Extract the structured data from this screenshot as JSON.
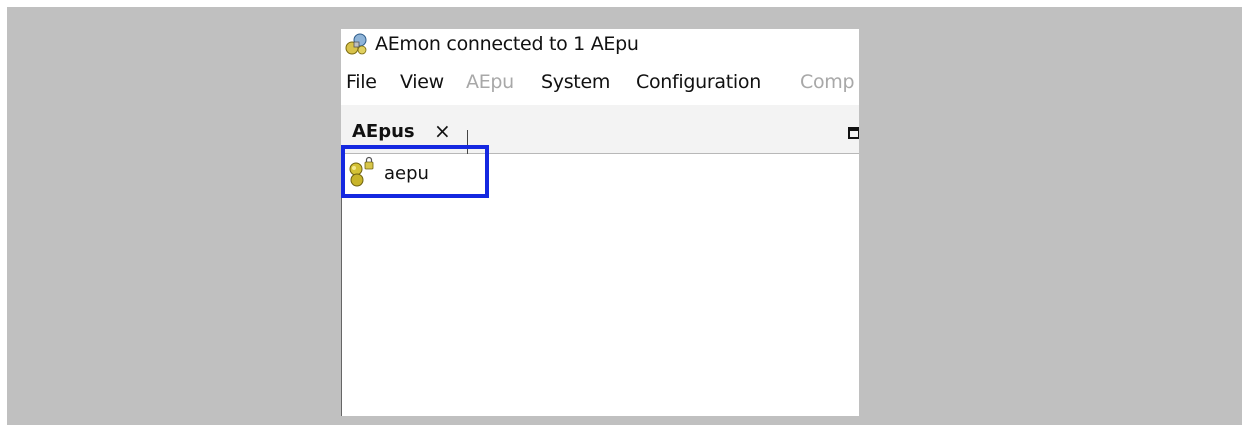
{
  "window": {
    "title": "AEmon connected to 1 AEpu",
    "app_icon": "network-satellite-icon"
  },
  "menu": {
    "items": [
      {
        "label": "File",
        "disabled": false
      },
      {
        "label": "View",
        "disabled": false
      },
      {
        "label": "AEpu",
        "disabled": true
      },
      {
        "label": "System",
        "disabled": false
      },
      {
        "label": "Configuration",
        "disabled": false
      },
      {
        "label": "Comp",
        "disabled": true
      }
    ]
  },
  "tabs": {
    "active": {
      "label": "AEpus",
      "close_glyph": "×"
    },
    "maximize_icon": "maximize-icon"
  },
  "tree": {
    "items": [
      {
        "label": "aepu",
        "icon": "locked-device-icon"
      }
    ]
  },
  "colors": {
    "backdrop": "#c0c0c0",
    "highlight": "#1428e0",
    "disabled_text": "#a8a8a8"
  }
}
